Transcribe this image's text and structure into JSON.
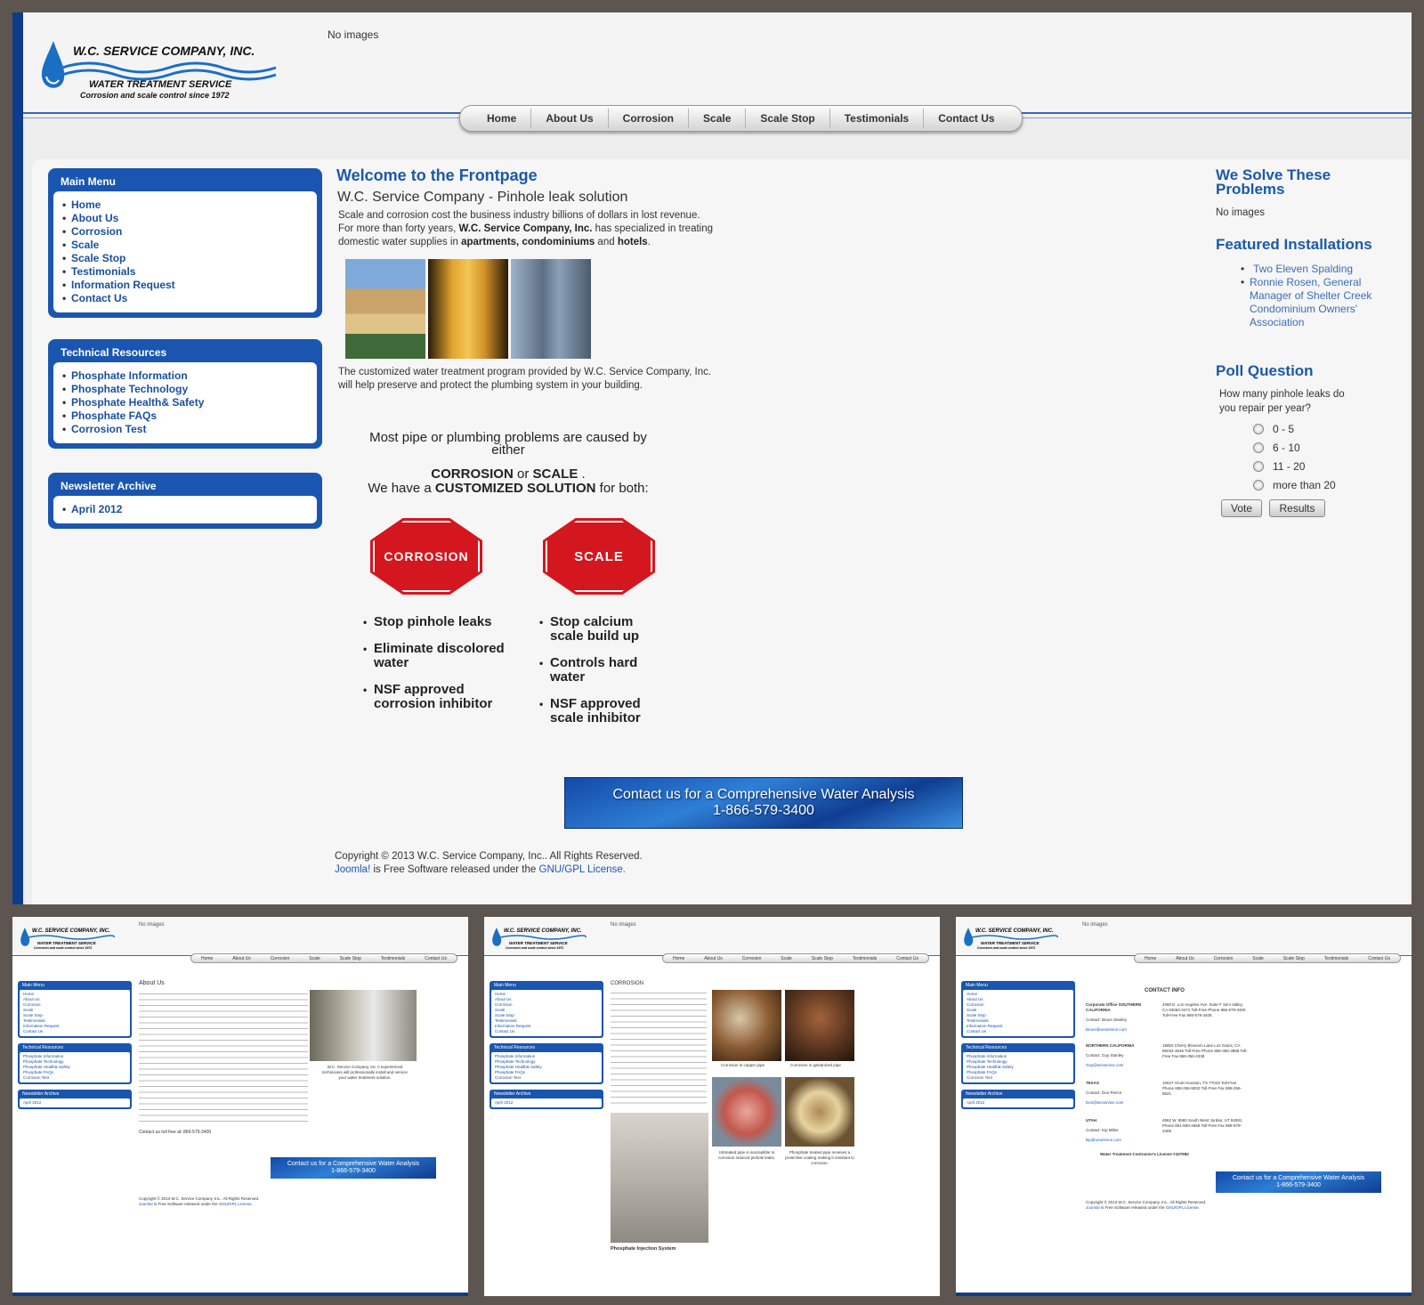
{
  "site": {
    "logo": {
      "name": "W.C. SERVICE COMPANY, INC.",
      "tagline1": "WATER TREATMENT SERVICE",
      "tagline2": "Corrosion and scale control since 1972"
    },
    "header_no_images": "No images"
  },
  "nav": [
    "Home",
    "About Us",
    "Corrosion",
    "Scale",
    "Scale Stop",
    "Testimonials",
    "Contact Us"
  ],
  "sidebar": {
    "main_menu": {
      "title": "Main Menu",
      "items": [
        "Home",
        "About Us",
        "Corrosion",
        "Scale",
        "Scale Stop",
        "Testimonials",
        "Information Request",
        "Contact Us"
      ]
    },
    "technical": {
      "title": "Technical Resources",
      "items": [
        "Phosphate Information",
        "Phosphate Technology",
        "Phosphate Health& Safety",
        "Phosphate FAQs",
        "Corrosion Test"
      ]
    },
    "newsletter": {
      "title": "Newsletter Archive",
      "items": [
        "April 2012"
      ]
    }
  },
  "main": {
    "welcome": "Welcome to the Frontpage",
    "subtitle": "W.C. Service Company - Pinhole leak solution",
    "intro": {
      "line1": "Scale and corrosion cost the business industry billions of dollars in lost revenue.",
      "line2a": "For more than forty years, ",
      "line2b": "W.C. Service Company, Inc.",
      "line2c": " has specialized in treating",
      "line3a": "domestic water supplies in ",
      "line3b": "apartments, condominiums",
      "line3c": " and ",
      "line3d": "hotels",
      "line3e": "."
    },
    "program_line1": "The customized water treatment program  provided by W.C. Service Company, Inc.",
    "program_line2": "will help preserve and  protect the  plumbing  system in your building.",
    "problems_line1": "Most pipe or plumbing problems are caused by",
    "problems_line2": "either",
    "corrosion_word": "CORROSION",
    "or_word": " or ",
    "scale_word": "SCALE",
    "scale_dot": " .",
    "have_a": "We have a ",
    "customized": " CUSTOMIZED SOLUTION",
    "for_both": " for both:",
    "sign_corrosion": "CORROSION",
    "sign_scale": "SCALE",
    "corrosion_bullets": [
      "Stop pinhole leaks",
      "Eliminate discolored water",
      "NSF approved corrosion inhibitor"
    ],
    "scale_bullets": [
      "Stop calcium scale build up",
      "Controls hard water",
      "NSF approved scale inhibitor"
    ],
    "banner_line1": "Contact us for a Comprehensive Water Analysis",
    "banner_line2": "1-866-579-3400",
    "copyright": "Copyright © 2013 W.C. Service Company, Inc.. All Rights Reserved.",
    "joomla": "Joomla!",
    "free_software": " is Free Software released under the ",
    "gpl": "GNU/GPL License."
  },
  "right": {
    "solve_title": "We Solve These Problems",
    "solve_noimg": "No images",
    "featured_title": "Featured Installations",
    "featured_items": [
      "Two Eleven Spalding",
      "Ronnie Rosen, General Manager of Shelter Creek Condominium Owners' Association"
    ],
    "poll_title": "Poll Question",
    "poll_question": "How many pinhole leaks do you repair per year?",
    "poll_options": [
      "0 - 5",
      "6 - 10",
      "11 - 20",
      "more than 20"
    ],
    "vote": "Vote",
    "results": "Results"
  },
  "thumbs": {
    "about": {
      "heading": "About Us",
      "caption": "W.C. Service Company, Inc.'s experienced technicians will professionally install and service your water treatment solution.",
      "contact_line": "Contact us toll free at: 866-579-3400"
    },
    "corrosion": {
      "heading": "CORROSION",
      "captions": [
        "Corrosion in copper pipe",
        "Corrosion in galvanized pipe",
        "Untreated pipe is susceptible to corrosion induced pinhole leaks.",
        "Phosphate treated pipe receives a protective coating making it resistant to corrosion."
      ],
      "injection": "Phosphate Injection System"
    },
    "contact": {
      "heading": "CONTACT INFO",
      "license": "Water Treatment Contractor's License #437982",
      "offices": [
        {
          "region": "Corporate Office SOUTHERN CALIFORNIA",
          "contact": "Contact: Bruce Stanley",
          "email": "Bruce@wcservice.com",
          "address": "4080 E. Los Angeles Ave. Suite F Simi Valley, CA 93063-3471 Toll-Free Phone 866-579-3400 Toll-Free Fax 866-579-3405"
        },
        {
          "region": "NORTHERN CALIFORNIA",
          "contact": "Contact: Guy Stanley",
          "email": "Guy@wcservice.com",
          "address": "15853 Cherry Blossom Lane Los Gatos, CA 95032-3546 Toll-Free Phone 866-356-3888 Toll-Free Fax 866-356-4338"
        },
        {
          "region": "TEXAS",
          "contact": "Contact: Don Pierce",
          "email": "Don@wcservice.com",
          "address": "10627 Alcott Houston, TX 77043 Toll-Free Phone 888-256-9002 Toll-Free Fax 888-256-8621"
        },
        {
          "region": "UTAH",
          "contact": "Contact: Kip Miller",
          "email": "kip@wcservice.com",
          "address": "4962 W. 8580 South West Jordan, UT 84081 Phone 801-550-4658 Toll-Free Fax 888-579-3405"
        }
      ]
    }
  }
}
